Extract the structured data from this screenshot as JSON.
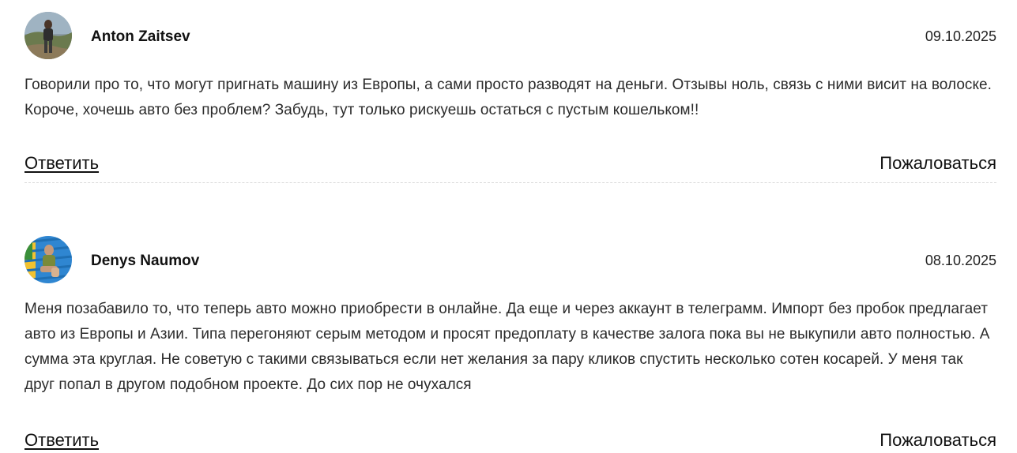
{
  "reviews": [
    {
      "author": "Anton Zaitsev",
      "date": "09.10.2025",
      "text": "Говорили про то, что могут пригнать машину из Европы, а сами просто разводят на деньги. Отзывы ноль, связь с ними висит на волоске. Короче, хочешь авто без проблем? Забудь, тут только рискуешь остаться с пустым кошельком!!",
      "reply_label": "Ответить",
      "complain_label": "Пожаловаться"
    },
    {
      "author": "Denys Naumov",
      "date": "08.10.2025",
      "text": "Меня позабавило то, что теперь авто можно приобрести в онлайне. Да еще и через аккаунт в телеграмм. Импорт без пробок предлагает авто из Европы и Азии. Типа перегоняют серым методом и просят предоплату в качестве залога пока вы не выкупили авто полностью. А сумма эта круглая. Не советую с такими связываться если нет желания за пару кликов спустить несколько сотен косарей. У меня так друг попал в другом подобном проекте. До сих пор не очухался",
      "reply_label": "Ответить",
      "complain_label": "Пожаловаться"
    }
  ]
}
